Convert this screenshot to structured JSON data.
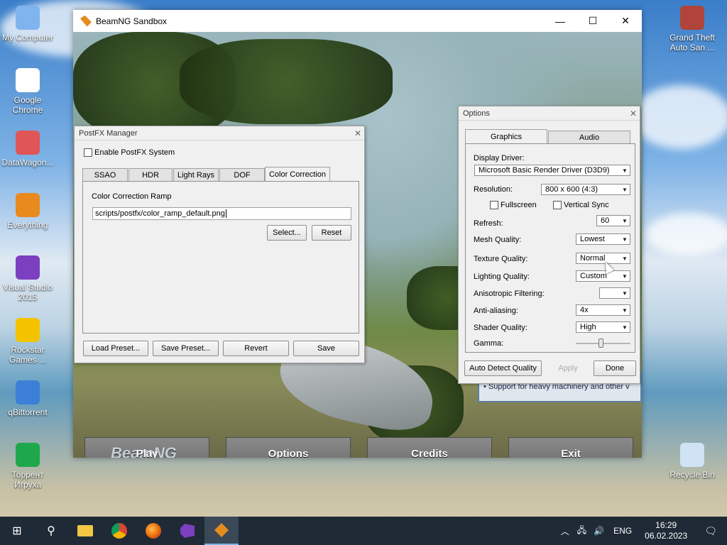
{
  "desktop": {
    "icons_left": [
      {
        "label": "My Computer",
        "glyph": "monitor-icon"
      },
      {
        "label": "Google Chrome",
        "glyph": "chrome-icon"
      },
      {
        "label": "DataWagon...",
        "glyph": "datawagon-icon"
      },
      {
        "label": "Everything",
        "glyph": "everything-icon"
      },
      {
        "label": "Visual Studio 2015",
        "glyph": "visual-studio-icon"
      },
      {
        "label": "Rockstar Games ...",
        "glyph": "rockstar-icon"
      },
      {
        "label": "qBittorrent",
        "glyph": "qbittorrent-icon"
      },
      {
        "label": "Торрент Игруха",
        "glyph": "torrent-igruha-icon"
      }
    ],
    "icons_right": [
      {
        "label": "Grand Theft Auto San ...",
        "glyph": "gta-icon"
      },
      {
        "label": "Recycle Bin",
        "glyph": "recycle-bin-icon"
      }
    ]
  },
  "game_window": {
    "title": "BeamNG Sandbox",
    "controls": {
      "minimize": "—",
      "maximize": "☐",
      "close": "✕"
    },
    "menu": {
      "play": "Play",
      "options": "Options",
      "credits": "Credits",
      "exit": "Exit"
    },
    "logo_text": "BeamNG",
    "sign_text": "• Support for heavy machinery and other v"
  },
  "postfx": {
    "title": "PostFX Manager",
    "enable_label": "Enable PostFX System",
    "tabs": [
      "SSAO",
      "HDR",
      "Light Rays",
      "DOF",
      "Color Correction"
    ],
    "active_tab": "Color Correction",
    "ramp_label": "Color Correction Ramp",
    "ramp_value": "scripts/postfx/color_ramp_default.png",
    "select_label": "Select...",
    "reset_label": "Reset",
    "load_preset": "Load Preset...",
    "save_preset": "Save Preset...",
    "revert": "Revert",
    "save": "Save"
  },
  "options": {
    "title": "Options",
    "tabs": [
      "Graphics",
      "Audio"
    ],
    "display_driver_label": "Display Driver:",
    "display_driver_value": "Microsoft Basic Render Driver (D3D9)",
    "resolution_label": "Resolution:",
    "resolution_value": "800 x 600  (4:3)",
    "fullscreen_label": "Fullscreen",
    "vsync_label": "Vertical Sync",
    "refresh_label": "Refresh:",
    "refresh_value": "60",
    "mesh_label": "Mesh Quality:",
    "mesh_value": "Lowest",
    "texture_label": "Texture Quality:",
    "texture_value": "Normal",
    "lighting_label": "Lighting Quality:",
    "lighting_value": "Custom",
    "aniso_label": "Anisotropic Filtering:",
    "aniso_value": "",
    "aa_label": "Anti-aliasing:",
    "aa_value": "4x",
    "shader_label": "Shader Quality:",
    "shader_value": "High",
    "gamma_label": "Gamma:",
    "gamma_level": 0.45,
    "auto_detect": "Auto Detect Quality",
    "apply": "Apply",
    "done": "Done"
  },
  "taskbar": {
    "apps": [
      "start-icon",
      "search-icon",
      "file-explorer-icon",
      "chrome-icon",
      "firefox-icon",
      "visual-studio-icon",
      "beamng-icon"
    ],
    "lang": "ENG",
    "time": "16:29",
    "date": "06.02.2023"
  }
}
